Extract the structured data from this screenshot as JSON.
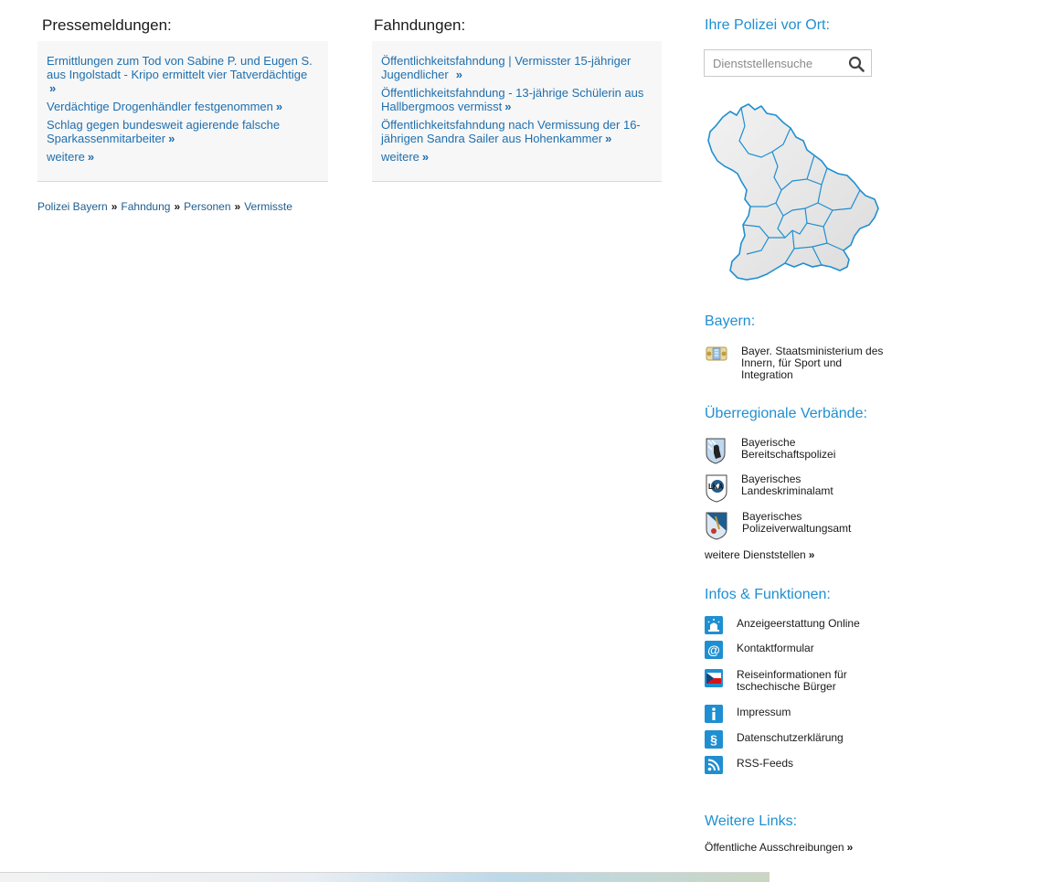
{
  "press": {
    "title": "Pressemeldungen:",
    "items": [
      "Ermittlungen zum Tod von Sabine P. und Eugen S. aus Ingolstadt - Kripo ermittelt vier Tatverdächtige",
      "Verdächtige Drogenhändler festgenommen",
      "Schlag gegen bundesweit agierende falsche Sparkassenmitarbeiter"
    ],
    "more": "weitere"
  },
  "fahndungen": {
    "title": "Fahndungen:",
    "items": [
      "Öffentlichkeitsfahndung | Vermisster 15-jähriger Jugendlicher",
      "Öffentlichkeitsfahndung - 13-jährige Schülerin aus Hallbergmoos vermisst",
      "Öffentlichkeitsfahndung nach Vermissung der 16-jährigen Sandra Sailer aus Hohenkammer"
    ],
    "more": "weitere"
  },
  "breadcrumb": [
    "Polizei Bayern",
    "Fahndung",
    "Personen",
    "Vermisste"
  ],
  "sidebar": {
    "vor_ort": {
      "title": "Ihre Polizei vor Ort:",
      "search_placeholder": "Dienststellensuche"
    },
    "bayern": {
      "title": "Bayern:",
      "entry": "Bayer. Staatsministerium des Innern, für Sport und Integration"
    },
    "verbaende": {
      "title": "Überregionale Verbände:",
      "items": [
        "Bayerische Bereitschaftspolizei",
        "Bayerisches Landeskriminalamt",
        "Bayerisches Polizeiverwaltungsamt"
      ],
      "more": "weitere Dienststellen"
    },
    "infos": {
      "title": "Infos & Funktionen:",
      "items": [
        {
          "label": "Anzeigeerstattung Online",
          "icon": "siren-icon"
        },
        {
          "label": "Kontaktformular",
          "icon": "at-sign-icon"
        },
        {
          "label": "Reiseinformationen für tschechische Bürger",
          "icon": "czech-flag-icon"
        },
        {
          "label": "Impressum",
          "icon": "info-icon"
        },
        {
          "label": "Datenschutzerklärung",
          "icon": "paragraph-icon"
        },
        {
          "label": "RSS-Feeds",
          "icon": "rss-icon"
        }
      ]
    },
    "weitere_links": {
      "title": "Weitere Links:",
      "items": [
        "Öffentliche Ausschreibungen"
      ]
    }
  },
  "colors": {
    "link": "#1f6fae",
    "accent": "#1f8fd1",
    "box_bg": "#f7f7f7"
  }
}
